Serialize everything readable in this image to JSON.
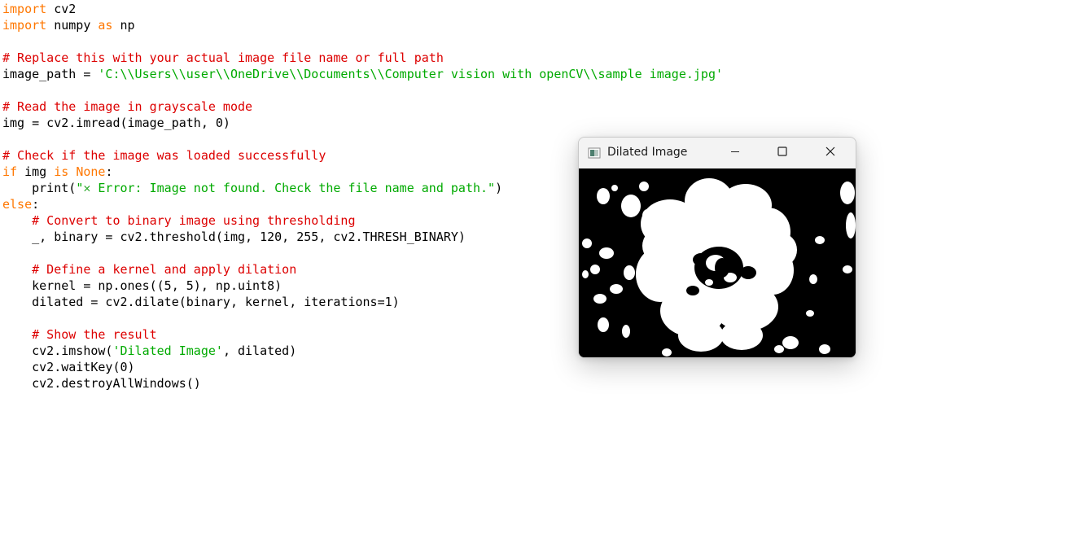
{
  "code": {
    "lines": [
      [
        {
          "t": "import",
          "c": "kw"
        },
        {
          "t": " cv2",
          "c": ""
        }
      ],
      [
        {
          "t": "import",
          "c": "kw"
        },
        {
          "t": " numpy ",
          "c": ""
        },
        {
          "t": "as",
          "c": "kw"
        },
        {
          "t": " np",
          "c": ""
        }
      ],
      [],
      [
        {
          "t": "# Replace this with your actual image file name or full path",
          "c": "cm"
        }
      ],
      [
        {
          "t": "image_path = ",
          "c": ""
        },
        {
          "t": "'C:\\\\Users\\\\user\\\\OneDrive\\\\Documents\\\\Computer vision with openCV\\\\sample image.jpg'",
          "c": "st"
        }
      ],
      [],
      [
        {
          "t": "# Read the image in grayscale mode",
          "c": "cm"
        }
      ],
      [
        {
          "t": "img = cv2.imread(image_path, 0)",
          "c": ""
        }
      ],
      [],
      [
        {
          "t": "# Check if the image was loaded successfully",
          "c": "cm"
        }
      ],
      [
        {
          "t": "if",
          "c": "kw"
        },
        {
          "t": " img ",
          "c": ""
        },
        {
          "t": "is",
          "c": "kw"
        },
        {
          "t": " ",
          "c": ""
        },
        {
          "t": "None",
          "c": "kw"
        },
        {
          "t": ":",
          "c": ""
        }
      ],
      [
        {
          "t": "    print(",
          "c": ""
        },
        {
          "t": "\"",
          "c": "st"
        },
        {
          "t": "✕",
          "c": "xmark"
        },
        {
          "t": " Error: Image not found. Check the file name and path.\"",
          "c": "st"
        },
        {
          "t": ")",
          "c": ""
        }
      ],
      [
        {
          "t": "else",
          "c": "kw"
        },
        {
          "t": ":",
          "c": ""
        }
      ],
      [
        {
          "t": "    ",
          "c": ""
        },
        {
          "t": "# Convert to binary image using thresholding",
          "c": "cm"
        }
      ],
      [
        {
          "t": "    _, binary = cv2.threshold(img, 120, 255, cv2.THRESH_BINARY)",
          "c": ""
        }
      ],
      [],
      [
        {
          "t": "    ",
          "c": ""
        },
        {
          "t": "# Define a kernel and apply dilation",
          "c": "cm"
        }
      ],
      [
        {
          "t": "    kernel = np.ones((5, 5), np.uint8)",
          "c": ""
        }
      ],
      [
        {
          "t": "    dilated = cv2.dilate(binary, kernel, iterations=1)",
          "c": ""
        }
      ],
      [],
      [
        {
          "t": "    ",
          "c": ""
        },
        {
          "t": "# Show the result",
          "c": "cm"
        }
      ],
      [
        {
          "t": "    cv2.imshow(",
          "c": ""
        },
        {
          "t": "'Dilated Image'",
          "c": "st"
        },
        {
          "t": ", dilated)",
          "c": ""
        }
      ],
      [
        {
          "t": "    cv2.waitKey(0)",
          "c": ""
        }
      ],
      [
        {
          "t": "    cv2.destroyAllWindows()",
          "c": ""
        }
      ]
    ]
  },
  "window": {
    "title": "Dilated Image",
    "icons": {
      "app": "opencv-window-icon",
      "minimize": "minimize-icon",
      "maximize": "maximize-icon",
      "close": "close-icon"
    },
    "image": "dilated-binary-flower-image"
  },
  "colors": {
    "keyword": "#ff7700",
    "comment": "#dd0000",
    "string": "#00aa00",
    "text": "#000000",
    "titlebar": "#f3f3f3",
    "image_background": "#000000",
    "image_foreground": "#ffffff"
  }
}
